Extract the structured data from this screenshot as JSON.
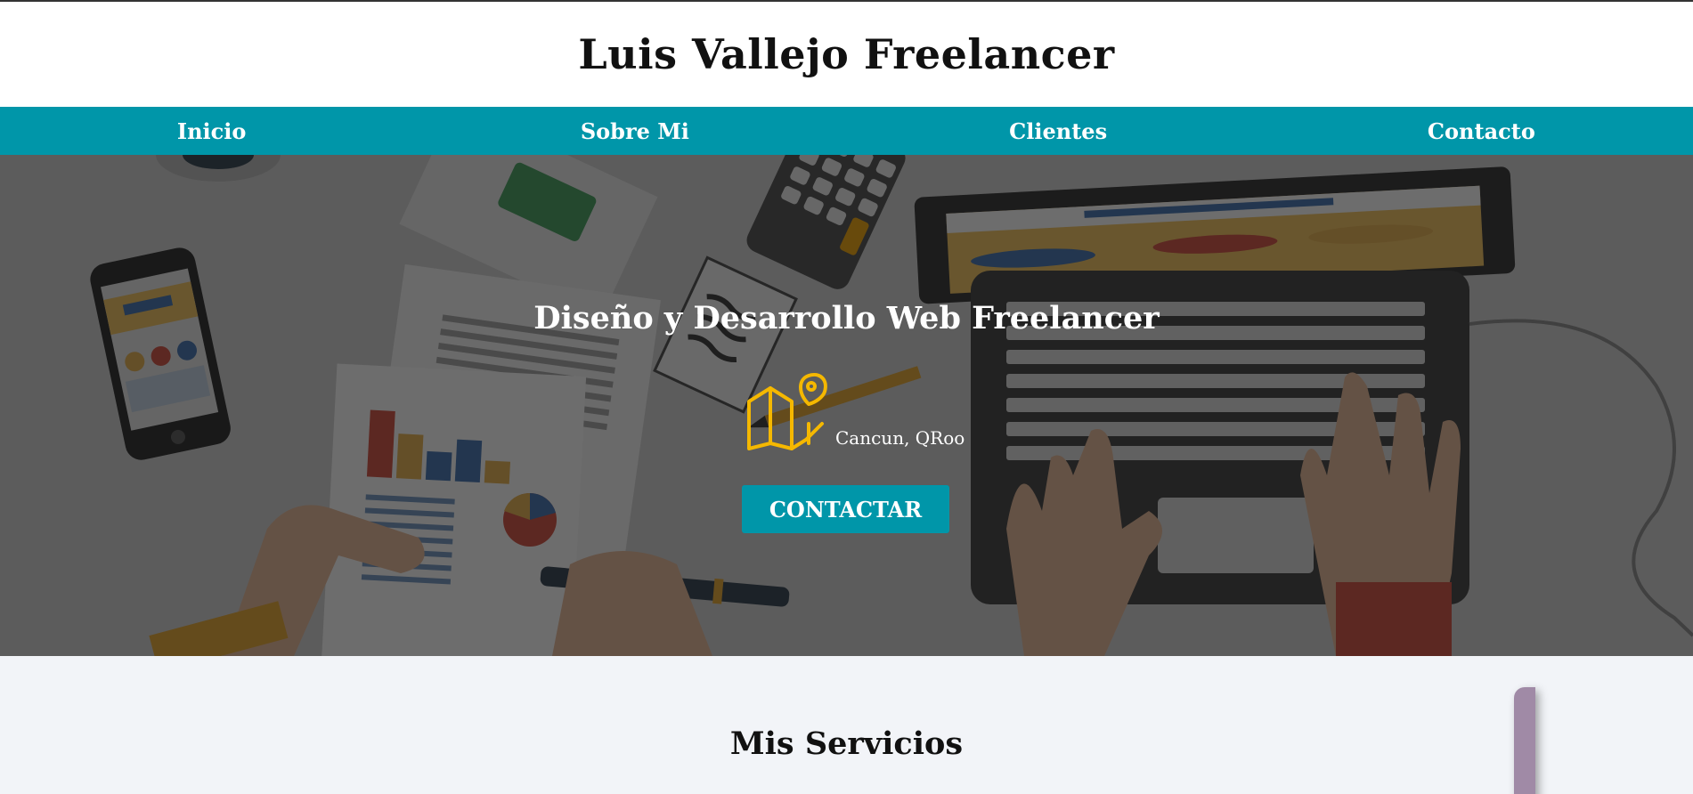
{
  "header": {
    "title": "Luis Vallejo Freelancer"
  },
  "nav": {
    "items": [
      {
        "label": "Inicio"
      },
      {
        "label": "Sobre Mi"
      },
      {
        "label": "Clientes"
      },
      {
        "label": "Contacto"
      }
    ]
  },
  "hero": {
    "title": "Diseño y Desarrollo Web Freelancer",
    "location": "Cancun, QRoo",
    "location_icon": "map-pin-icon",
    "cta_label": "CONTACTAR",
    "accent_color": "#0096a9",
    "icon_color": "#f5b800"
  },
  "services": {
    "title": "Mis Servicios"
  }
}
